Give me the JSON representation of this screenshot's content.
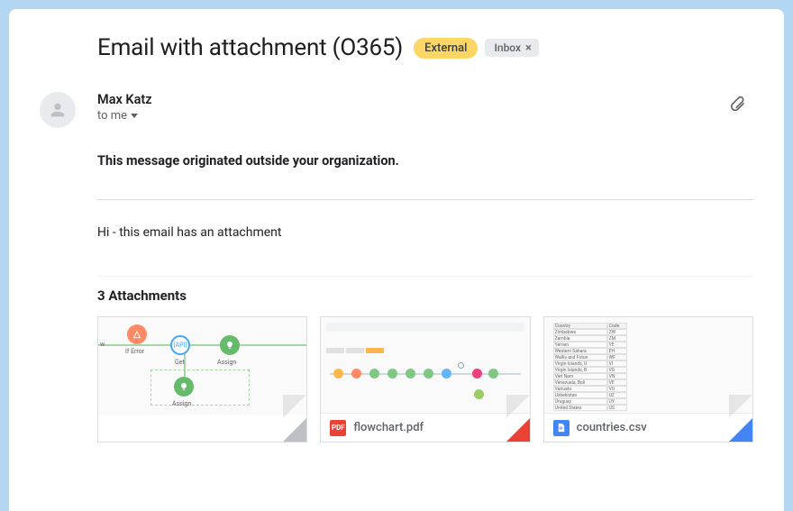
{
  "subject": "Email with attachment (O365)",
  "badges": {
    "external": "External",
    "inbox": "Inbox"
  },
  "sender": {
    "name": "Max Katz"
  },
  "recipient_line": "to me",
  "warning": "This message originated outside your organization.",
  "body": "Hi - this email has an attachment",
  "attachments_header": "3 Attachments",
  "attachments": [
    {
      "filename": "",
      "type": "image",
      "icon_color": ""
    },
    {
      "filename": "flowchart.pdf",
      "type": "pdf",
      "icon_label": "PDF",
      "icon_color": "#ea4335"
    },
    {
      "filename": "countries.csv",
      "type": "sheet",
      "icon_label": "",
      "icon_color": "#4285f4"
    }
  ],
  "colors": {
    "page_bg": "#b3d7f2",
    "external_badge": "#fdd663",
    "inbox_badge": "#e8eaed"
  }
}
